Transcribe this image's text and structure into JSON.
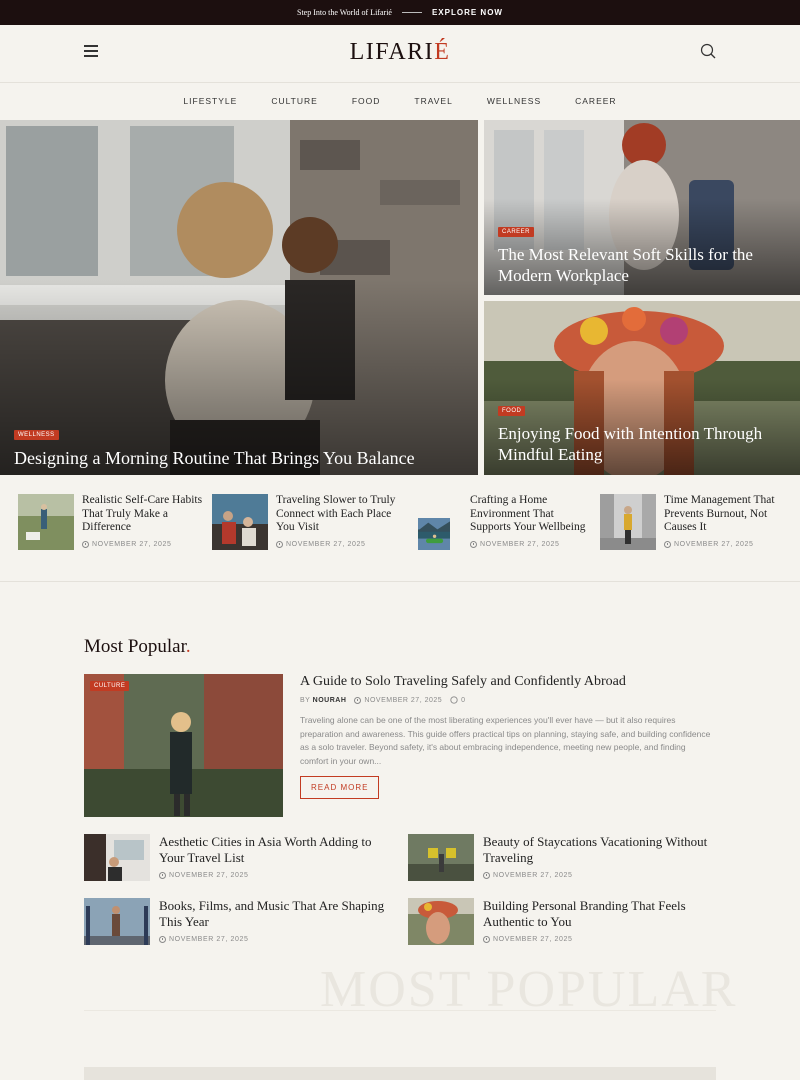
{
  "topbar": {
    "tagline": "Step Into the World of Lifarié",
    "cta": "EXPLORE NOW"
  },
  "header": {
    "logo_main": "LIFARI",
    "logo_accent": "É"
  },
  "nav": [
    "LIFESTYLE",
    "CULTURE",
    "FOOD",
    "TRAVEL",
    "WELLNESS",
    "CAREER"
  ],
  "hero": {
    "main": {
      "badge": "WELLNESS",
      "title": "Designing a Morning Routine That Brings You Balance"
    },
    "side1": {
      "badge": "CAREER",
      "title": "The Most Relevant Soft Skills for the Modern Workplace"
    },
    "side2": {
      "badge": "FOOD",
      "title": "Enjoying Food with Intention Through Mindful Eating"
    }
  },
  "mini_articles": [
    {
      "title": "Realistic Self-Care Habits That Truly Make a Difference",
      "date": "NOVEMBER 27, 2025"
    },
    {
      "title": "Traveling Slower to Truly Connect with Each Place You Visit",
      "date": "NOVEMBER 27, 2025"
    },
    {
      "title": "Crafting a Home Environment That Supports Your Wellbeing",
      "date": "NOVEMBER 27, 2025"
    },
    {
      "title": "Time Management That Prevents Burnout, Not Causes It",
      "date": "NOVEMBER 27, 2025"
    }
  ],
  "most_popular": {
    "heading": "Most Popular",
    "heading_dot": ".",
    "featured": {
      "badge": "CULTURE",
      "title": "A Guide to Solo Traveling Safely and Confidently Abroad",
      "by": "BY",
      "author": "NOURAH",
      "date": "NOVEMBER 27, 2025",
      "comments": "0",
      "excerpt": "Traveling alone can be one of the most liberating experiences you'll ever have — but it also requires preparation and awareness. This guide offers practical tips on planning, staying safe, and building confidence as a solo traveler. Beyond safety, it's about embracing independence, meeting new people, and finding comfort in your own...",
      "read_more": "READ MORE"
    },
    "items": [
      {
        "title": "Aesthetic Cities in Asia Worth Adding to Your Travel List",
        "date": "NOVEMBER 27, 2025"
      },
      {
        "title": "Beauty of Staycations Vacationing Without Traveling",
        "date": "NOVEMBER 27, 2025"
      },
      {
        "title": "Books, Films, and Music That Are Shaping This Year",
        "date": "NOVEMBER 27, 2025"
      },
      {
        "title": "Building Personal Branding That Feels Authentic to You",
        "date": "NOVEMBER 27, 2025"
      }
    ],
    "watermark": "MOST POPULAR"
  },
  "colors": {
    "accent": "#c23b22",
    "topbar_bg": "#1c0f0f",
    "page_bg": "#f5f3ee"
  }
}
